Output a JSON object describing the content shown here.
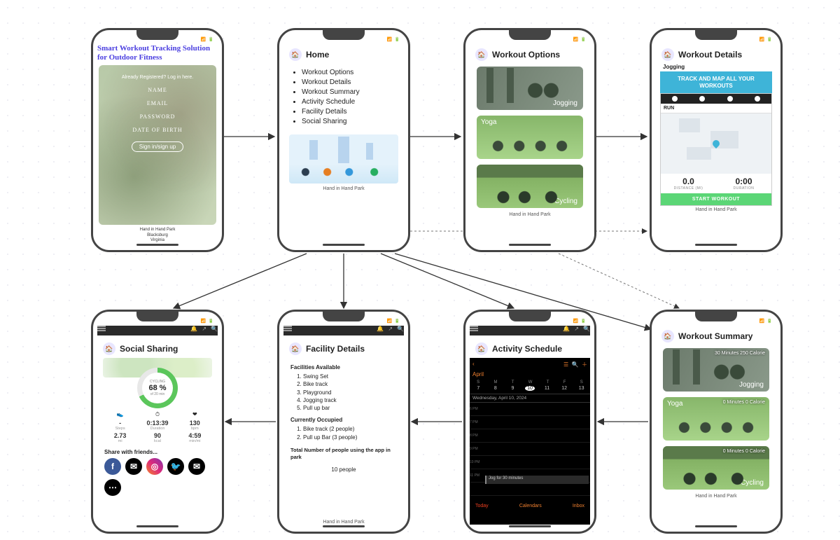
{
  "park_name": "Hand in Hand Park",
  "login": {
    "title": "Smart Workout Tracking Solution for Outdoor Fitness",
    "subtitle": "Already Registered? Log in here.",
    "fields": {
      "name": "NAME",
      "email": "EMAIL",
      "password": "PASSWORD",
      "dob": "DATE OF BIRTH"
    },
    "button": "Sign in/sign up",
    "footer_lines": [
      "Hand in Hand Park",
      "Blacksburg",
      "Virginia"
    ]
  },
  "home": {
    "title": "Home",
    "items": [
      "Workout Options",
      "Workout Details",
      "Workout Summary",
      "Activity Schedule",
      "Facility Details",
      "Social Sharing"
    ]
  },
  "workout_options": {
    "title": "Workout Options",
    "options": [
      {
        "label": "Jogging"
      },
      {
        "label": "Yoga"
      },
      {
        "label": "Cycling"
      }
    ]
  },
  "workout_details": {
    "title": "Workout Details",
    "activity": "Jogging",
    "banner": "TRACK AND MAP ALL YOUR WORKOUTS",
    "run_label": "RUN",
    "stats": {
      "distance_value": "0.0",
      "distance_label": "DISTANCE (MI)",
      "duration_value": "0:00",
      "duration_label": "DURATION"
    },
    "start_button": "START WORKOUT"
  },
  "workout_summary": {
    "title": "Workout Summary",
    "items": [
      {
        "label": "Jogging",
        "meta": "30 Minutes\n250 Calorie"
      },
      {
        "label": "Yoga",
        "meta": "0 Minutes\n0 Calorie"
      },
      {
        "label": "Cycling",
        "meta": "0 Minutes\n0 Calorie"
      }
    ]
  },
  "activity_schedule": {
    "title": "Activity Schedule",
    "month": "April",
    "days": [
      "S",
      "M",
      "T",
      "W",
      "T",
      "F",
      "S"
    ],
    "nums": [
      "7",
      "8",
      "9",
      "10",
      "11",
      "12",
      "13"
    ],
    "selected_date_label": "Wednesday, April 10, 2024",
    "event": "Jog for 30 minutes",
    "hours": [
      "6 PM",
      "7 PM",
      "8 PM",
      "9 PM",
      "10 PM",
      "11 PM"
    ],
    "footer": {
      "today": "Today",
      "calendars": "Calendars",
      "inbox": "Inbox"
    }
  },
  "facility_details": {
    "title": "Facility Details",
    "available_header": "Facilities Available",
    "available": [
      "Swing Set",
      "Bike track",
      "Playground",
      "Jogging track",
      "Pull up bar"
    ],
    "occupied_header": "Currently Occupied",
    "occupied": [
      "Bike track (2 people)",
      "Pull up Bar (3 people)"
    ],
    "total_header": "Total Number of people using the app in park",
    "total_value": "10 people"
  },
  "social_sharing": {
    "title": "Social Sharing",
    "ring": {
      "label_top": "CYCLING",
      "percent": "68 %",
      "label_bottom": "of 20 min"
    },
    "stats_row1": [
      {
        "icon": "👟",
        "value": "-",
        "label": "Steps"
      },
      {
        "icon": "⏱",
        "value": "0:13:39",
        "label": "Duration"
      },
      {
        "icon": "❤",
        "value": "130",
        "label": "bpm"
      }
    ],
    "stats_row2": [
      {
        "icon": "📏",
        "value": "2.73",
        "label": "mi"
      },
      {
        "icon": "🔥",
        "value": "90",
        "label": "kcal"
      },
      {
        "icon": "⏲",
        "value": "4:59",
        "label": "min/mi"
      }
    ],
    "share_label": "Share with friends...",
    "icons": [
      "facebook",
      "messenger",
      "instagram",
      "twitter",
      "mail",
      "more"
    ]
  }
}
